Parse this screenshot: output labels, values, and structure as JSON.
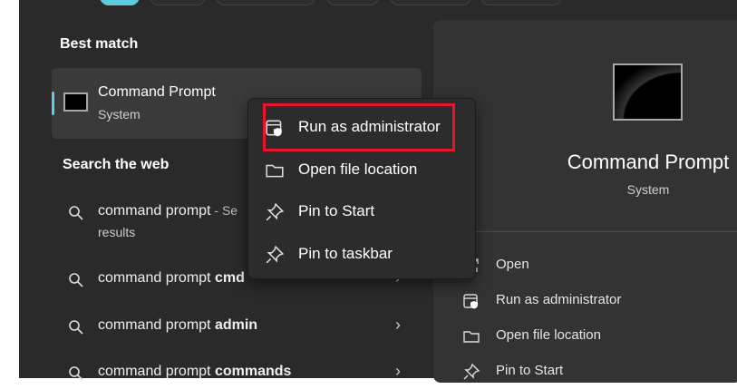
{
  "best_match": {
    "heading": "Best match",
    "app_name": "Command Prompt",
    "app_type": "System"
  },
  "search_web": {
    "heading": "Search the web",
    "items": [
      {
        "text": "command prompt",
        "suffix": " - Se",
        "line2": "results"
      },
      {
        "text": "command prompt ",
        "bold": "cmd"
      },
      {
        "text": "command prompt ",
        "bold": "admin"
      },
      {
        "text": "command prompt ",
        "bold": "commands"
      }
    ]
  },
  "context_menu": {
    "items": [
      {
        "label": "Run as administrator",
        "icon": "shield-window-icon"
      },
      {
        "label": "Open file location",
        "icon": "folder-icon"
      },
      {
        "label": "Pin to Start",
        "icon": "pin-icon"
      },
      {
        "label": "Pin to taskbar",
        "icon": "pin-icon"
      }
    ]
  },
  "detail": {
    "app_name": "Command Prompt",
    "app_type": "System",
    "actions": [
      {
        "label": "Open",
        "icon": "open-icon"
      },
      {
        "label": "Run as administrator",
        "icon": "shield-window-icon"
      },
      {
        "label": "Open file location",
        "icon": "folder-icon"
      },
      {
        "label": "Pin to Start",
        "icon": "pin-icon"
      }
    ]
  },
  "colors": {
    "accent": "#5fcde0",
    "highlight": "#e8142c"
  }
}
